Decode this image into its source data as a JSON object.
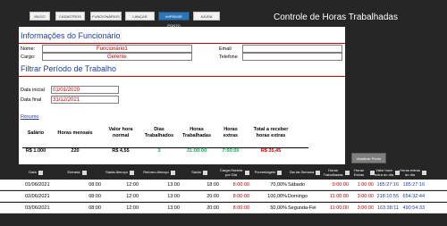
{
  "nav": [
    {
      "label": "INICIO",
      "active": false
    },
    {
      "label": "CADASTROS",
      "active": false
    },
    {
      "label": "FUNCIONÁRIOS",
      "active": false
    },
    {
      "label": "LANÇAR HORAS",
      "active": false
    },
    {
      "label": "IMPRIMIR PONTO",
      "active": true
    },
    {
      "label": "AJUDA",
      "active": false
    }
  ],
  "app_title": "Controle de Horas Trabalhadas",
  "info": {
    "title": "Informações do Funcionário",
    "nome_label": "Nome:",
    "nome_value": "Funcionário1",
    "cargo_label": "Cargo:",
    "cargo_value": "Gerente",
    "email_label": "Email",
    "email_value": "",
    "telefone_label": "Telefone",
    "telefone_value": ""
  },
  "filter": {
    "title": "Filtrar Período de Trabalho",
    "inicial_label": "Data inicial",
    "inicial_value": "01/01/2020",
    "final_label": "Data final",
    "final_value": "31/12/2021"
  },
  "resumo": {
    "title": "Resumo",
    "headers": [
      "Salário",
      "Horas mensais",
      "Valor hora normal",
      "Dias Trabalhados",
      "Horas Trabalhadas",
      "Horas extras",
      "Total a receber horas extras"
    ],
    "values": [
      "R$ 1.000",
      "220",
      "R$ 4,55",
      "3",
      "31:00:00",
      "7:00:00",
      "R$ 35,45"
    ]
  },
  "update_button": "Atualizar Ponto",
  "table": {
    "headers": [
      "Data",
      "Entrada",
      "Saída Almoço",
      "Retorno Almoço",
      "Saída",
      "Carga Horária por Dia",
      "Porcentagem",
      "Dia da Semana",
      "Horas Trabalhadas",
      "Horas Extras",
      "Valor hora extra do dia",
      "Horas extras do dia"
    ],
    "rows": [
      [
        "01/06/2021",
        "08:00",
        "12:00",
        "13:00",
        "18:00",
        "8:00:00",
        "70,00%",
        "Sábado",
        "9:00:00",
        "1:00:00",
        "185:27:16",
        "185:27:16"
      ],
      [
        "02/06/2021",
        "08:00",
        "12:00",
        "13:00",
        "20:00",
        "8:00:00",
        "100,00%",
        "Domingo",
        "11:00:00",
        "3:00:00",
        "218:10:55",
        "654:32:44"
      ],
      [
        "03/06/2021",
        "08:00",
        "12:00",
        "13:00",
        "20:00",
        "8:00:00",
        "50,00%",
        "Segunda-Fei",
        "11:00:00",
        "3:00:00",
        "163:38:11",
        "490:54:33"
      ]
    ]
  },
  "colors": {
    "section_title": "#1f3e9c",
    "value_red": "#c00000",
    "nav_active": "#2e75b6",
    "background": "#262626"
  }
}
